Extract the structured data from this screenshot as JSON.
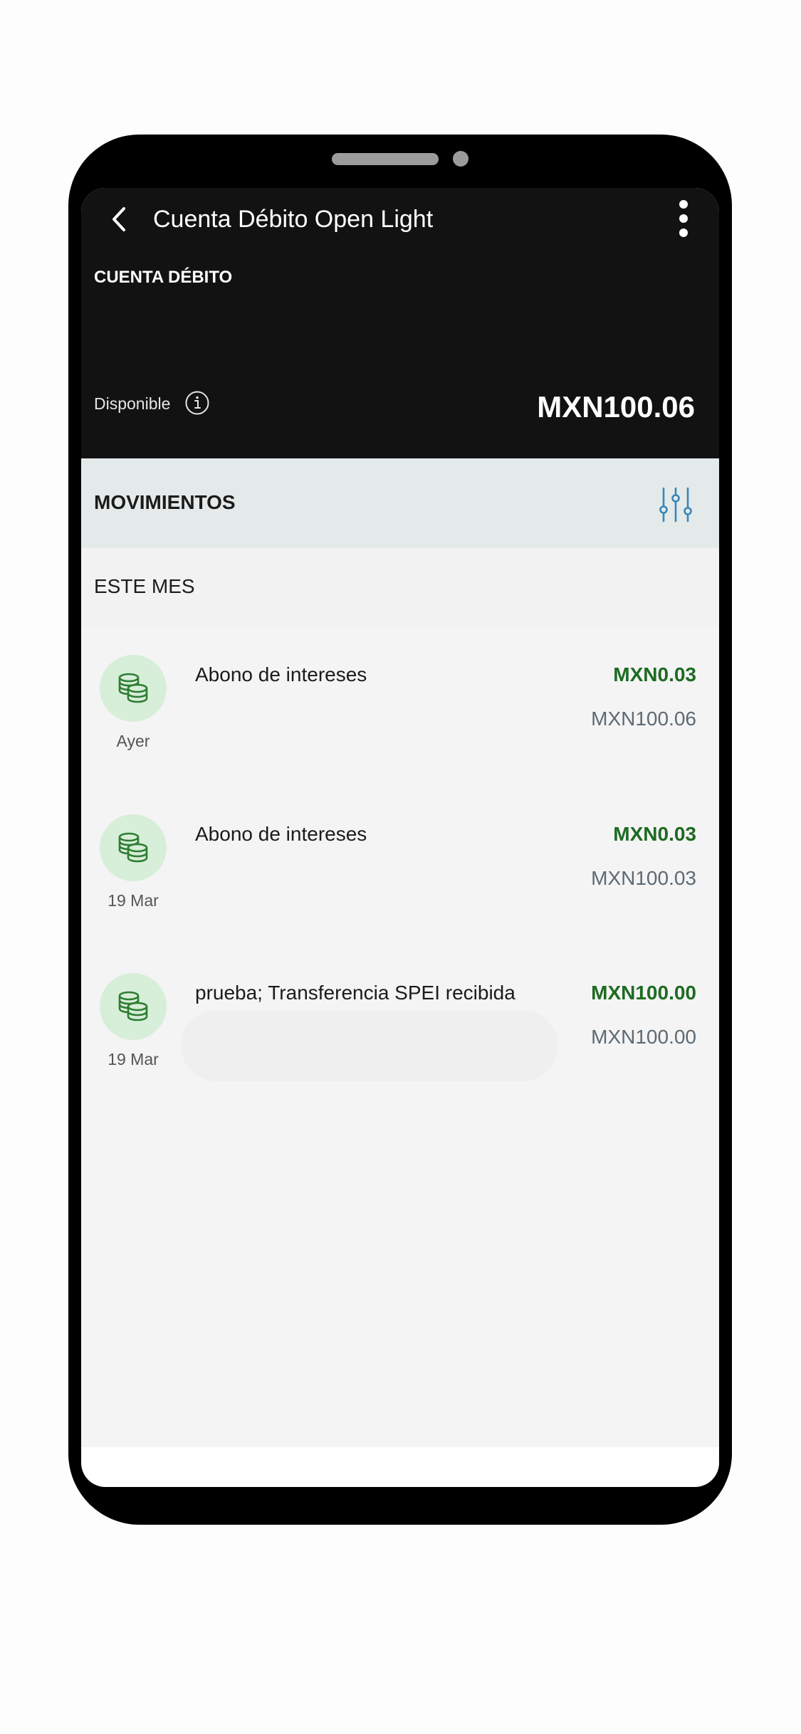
{
  "header": {
    "title": "Cuenta Débito Open Light",
    "account_type": "CUENTA DÉBITO",
    "available_label": "Disponible",
    "balance": "MXN100.06"
  },
  "movements": {
    "title": "MOVIMIENTOS",
    "section_title": "ESTE MES",
    "items": [
      {
        "description": "Abono de intereses",
        "date": "Ayer",
        "amount": "MXN0.03",
        "balance": "MXN100.06",
        "icon": "coins-icon"
      },
      {
        "description": "Abono de intereses",
        "date": "19 Mar",
        "amount": "MXN0.03",
        "balance": "MXN100.03",
        "icon": "coins-icon"
      },
      {
        "description": "prueba; Transferencia SPEI recibida",
        "date": "19 Mar",
        "amount": "MXN100.00",
        "balance": "MXN100.00",
        "icon": "coins-icon"
      }
    ]
  },
  "colors": {
    "header_bg": "#121212",
    "movements_bar_bg": "#e4eaea",
    "list_bg": "#f4f4f4",
    "credit_amount": "#1e6b22",
    "running_balance": "#5d6a73",
    "icon_circle_bg": "#d7eed9",
    "icon_stroke": "#2e7d32",
    "filter_icon": "#3a86b8"
  },
  "icons": {
    "back": "chevron-left-icon",
    "more": "more-vertical-icon",
    "info": "info-icon",
    "filter": "sliders-icon"
  }
}
